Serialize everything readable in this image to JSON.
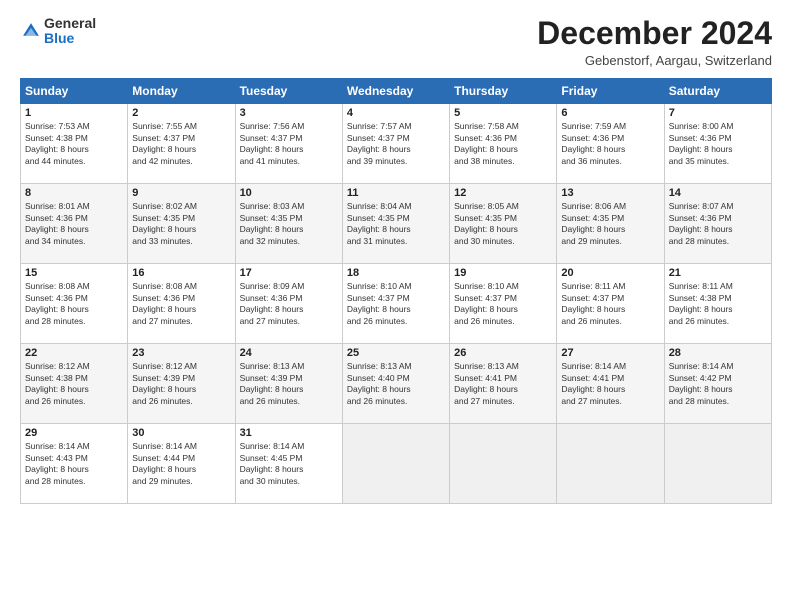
{
  "header": {
    "logo_line1": "General",
    "logo_line2": "Blue",
    "month_title": "December 2024",
    "location": "Gebenstorf, Aargau, Switzerland"
  },
  "weekdays": [
    "Sunday",
    "Monday",
    "Tuesday",
    "Wednesday",
    "Thursday",
    "Friday",
    "Saturday"
  ],
  "weeks": [
    [
      {
        "day": "1",
        "info": "Sunrise: 7:53 AM\nSunset: 4:38 PM\nDaylight: 8 hours\nand 44 minutes."
      },
      {
        "day": "2",
        "info": "Sunrise: 7:55 AM\nSunset: 4:37 PM\nDaylight: 8 hours\nand 42 minutes."
      },
      {
        "day": "3",
        "info": "Sunrise: 7:56 AM\nSunset: 4:37 PM\nDaylight: 8 hours\nand 41 minutes."
      },
      {
        "day": "4",
        "info": "Sunrise: 7:57 AM\nSunset: 4:37 PM\nDaylight: 8 hours\nand 39 minutes."
      },
      {
        "day": "5",
        "info": "Sunrise: 7:58 AM\nSunset: 4:36 PM\nDaylight: 8 hours\nand 38 minutes."
      },
      {
        "day": "6",
        "info": "Sunrise: 7:59 AM\nSunset: 4:36 PM\nDaylight: 8 hours\nand 36 minutes."
      },
      {
        "day": "7",
        "info": "Sunrise: 8:00 AM\nSunset: 4:36 PM\nDaylight: 8 hours\nand 35 minutes."
      }
    ],
    [
      {
        "day": "8",
        "info": "Sunrise: 8:01 AM\nSunset: 4:36 PM\nDaylight: 8 hours\nand 34 minutes."
      },
      {
        "day": "9",
        "info": "Sunrise: 8:02 AM\nSunset: 4:35 PM\nDaylight: 8 hours\nand 33 minutes."
      },
      {
        "day": "10",
        "info": "Sunrise: 8:03 AM\nSunset: 4:35 PM\nDaylight: 8 hours\nand 32 minutes."
      },
      {
        "day": "11",
        "info": "Sunrise: 8:04 AM\nSunset: 4:35 PM\nDaylight: 8 hours\nand 31 minutes."
      },
      {
        "day": "12",
        "info": "Sunrise: 8:05 AM\nSunset: 4:35 PM\nDaylight: 8 hours\nand 30 minutes."
      },
      {
        "day": "13",
        "info": "Sunrise: 8:06 AM\nSunset: 4:35 PM\nDaylight: 8 hours\nand 29 minutes."
      },
      {
        "day": "14",
        "info": "Sunrise: 8:07 AM\nSunset: 4:36 PM\nDaylight: 8 hours\nand 28 minutes."
      }
    ],
    [
      {
        "day": "15",
        "info": "Sunrise: 8:08 AM\nSunset: 4:36 PM\nDaylight: 8 hours\nand 28 minutes."
      },
      {
        "day": "16",
        "info": "Sunrise: 8:08 AM\nSunset: 4:36 PM\nDaylight: 8 hours\nand 27 minutes."
      },
      {
        "day": "17",
        "info": "Sunrise: 8:09 AM\nSunset: 4:36 PM\nDaylight: 8 hours\nand 27 minutes."
      },
      {
        "day": "18",
        "info": "Sunrise: 8:10 AM\nSunset: 4:37 PM\nDaylight: 8 hours\nand 26 minutes."
      },
      {
        "day": "19",
        "info": "Sunrise: 8:10 AM\nSunset: 4:37 PM\nDaylight: 8 hours\nand 26 minutes."
      },
      {
        "day": "20",
        "info": "Sunrise: 8:11 AM\nSunset: 4:37 PM\nDaylight: 8 hours\nand 26 minutes."
      },
      {
        "day": "21",
        "info": "Sunrise: 8:11 AM\nSunset: 4:38 PM\nDaylight: 8 hours\nand 26 minutes."
      }
    ],
    [
      {
        "day": "22",
        "info": "Sunrise: 8:12 AM\nSunset: 4:38 PM\nDaylight: 8 hours\nand 26 minutes."
      },
      {
        "day": "23",
        "info": "Sunrise: 8:12 AM\nSunset: 4:39 PM\nDaylight: 8 hours\nand 26 minutes."
      },
      {
        "day": "24",
        "info": "Sunrise: 8:13 AM\nSunset: 4:39 PM\nDaylight: 8 hours\nand 26 minutes."
      },
      {
        "day": "25",
        "info": "Sunrise: 8:13 AM\nSunset: 4:40 PM\nDaylight: 8 hours\nand 26 minutes."
      },
      {
        "day": "26",
        "info": "Sunrise: 8:13 AM\nSunset: 4:41 PM\nDaylight: 8 hours\nand 27 minutes."
      },
      {
        "day": "27",
        "info": "Sunrise: 8:14 AM\nSunset: 4:41 PM\nDaylight: 8 hours\nand 27 minutes."
      },
      {
        "day": "28",
        "info": "Sunrise: 8:14 AM\nSunset: 4:42 PM\nDaylight: 8 hours\nand 28 minutes."
      }
    ],
    [
      {
        "day": "29",
        "info": "Sunrise: 8:14 AM\nSunset: 4:43 PM\nDaylight: 8 hours\nand 28 minutes."
      },
      {
        "day": "30",
        "info": "Sunrise: 8:14 AM\nSunset: 4:44 PM\nDaylight: 8 hours\nand 29 minutes."
      },
      {
        "day": "31",
        "info": "Sunrise: 8:14 AM\nSunset: 4:45 PM\nDaylight: 8 hours\nand 30 minutes."
      },
      null,
      null,
      null,
      null
    ]
  ]
}
